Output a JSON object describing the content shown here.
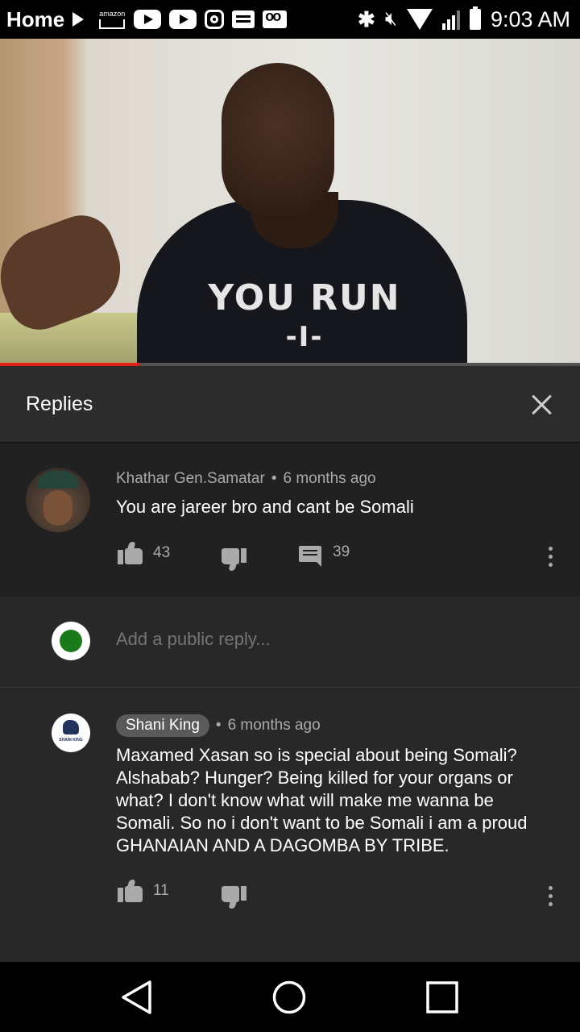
{
  "status_bar": {
    "app_label": "Home",
    "time": "9:03 AM",
    "amazon_label": "amazon"
  },
  "video": {
    "shirt_text_line1": "YOU RUN",
    "shirt_text_line2": "-I-",
    "progress_fraction": 0.24,
    "progress_color": "#e62117"
  },
  "replies_panel": {
    "title": "Replies"
  },
  "parent_comment": {
    "author": "Khathar Gen.Samatar",
    "time": "6 months ago",
    "text": "You are jareer bro and cant be Somali",
    "likes": "43",
    "replies": "39"
  },
  "add_reply": {
    "placeholder": "Add a public reply..."
  },
  "reply_comment": {
    "author": "Shani King",
    "time": "6 months ago",
    "text": "Maxamed Xasan so is special about being Somali? Alshabab? Hunger? Being killed for your organs or what? I don't know what will make me wanna be Somali. So no i don't want to be Somali i am a proud GHANAIAN AND A DAGOMBA BY TRIBE.",
    "likes": "11"
  },
  "colors": {
    "background": "#212121",
    "header": "#2c2c2c",
    "reply_area": "#282828",
    "muted_text": "#aaaaaa"
  }
}
